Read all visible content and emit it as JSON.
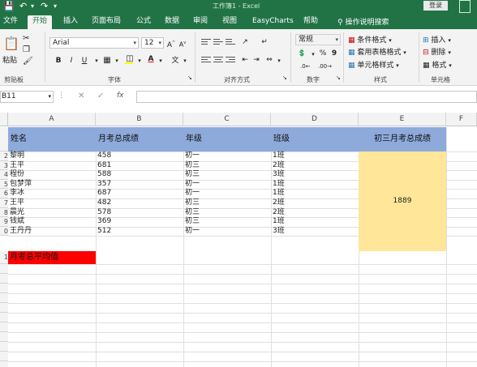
{
  "titlebar": {
    "doc_title": "工作簿1 - Excel",
    "login": "登录"
  },
  "tabs": [
    "文件",
    "开始",
    "插入",
    "页面布局",
    "公式",
    "数据",
    "审阅",
    "视图",
    "EasyCharts",
    "帮助"
  ],
  "tell_me": "操作说明搜索",
  "ribbon": {
    "paste": "粘贴",
    "clipboard": "剪贴板",
    "font_name": "Arial",
    "font_size": "12",
    "font_group": "字体",
    "align_group": "对齐方式",
    "number_format": "常规",
    "number_group": "数字",
    "cond_format": "条件格式",
    "table_format": "套用表格格式",
    "cell_style": "单元格样式",
    "style_group": "样式",
    "insert": "插入",
    "delete": "删除",
    "format": "格式",
    "cells_group": "单元格",
    "bold": "B",
    "italic": "I",
    "underline": "U",
    "font_color_letter": "A",
    "fill_color": "#ffff00",
    "font_color": "#ff0000",
    "percent": "%",
    "comma": "9"
  },
  "formula_bar": {
    "name_box": "B11",
    "fx": "fx",
    "value": ""
  },
  "grid": {
    "columns": [
      "A",
      "B",
      "C",
      "D",
      "E",
      "F"
    ],
    "header_row": [
      "姓名",
      "月考总成绩",
      "年级",
      "班级",
      "初三月考总成绩"
    ],
    "header_color": "#8eaadb",
    "rows": [
      [
        "黎明",
        "458",
        "初一",
        "1班"
      ],
      [
        "王平",
        "681",
        "初三",
        "2班"
      ],
      [
        "程份",
        "588",
        "初三",
        "3班"
      ],
      [
        "包梦萍",
        "357",
        "初一",
        "1班"
      ],
      [
        "李冰",
        "687",
        "初一",
        "1班"
      ],
      [
        "王平",
        "482",
        "初三",
        "2班"
      ],
      [
        "晨光",
        "578",
        "初三",
        "2班"
      ],
      [
        "钱斌",
        "369",
        "初三",
        "1班"
      ],
      [
        "王丹丹",
        "512",
        "初一",
        "3班"
      ]
    ],
    "merged_total": "1889",
    "merged_color": "#ffe699",
    "avg_label": "月考总平均值",
    "avg_color": "#ff0000",
    "row_numbers": [
      "2",
      "3",
      "4",
      "5",
      "6",
      "7",
      "8",
      "9",
      "0",
      "1"
    ]
  }
}
